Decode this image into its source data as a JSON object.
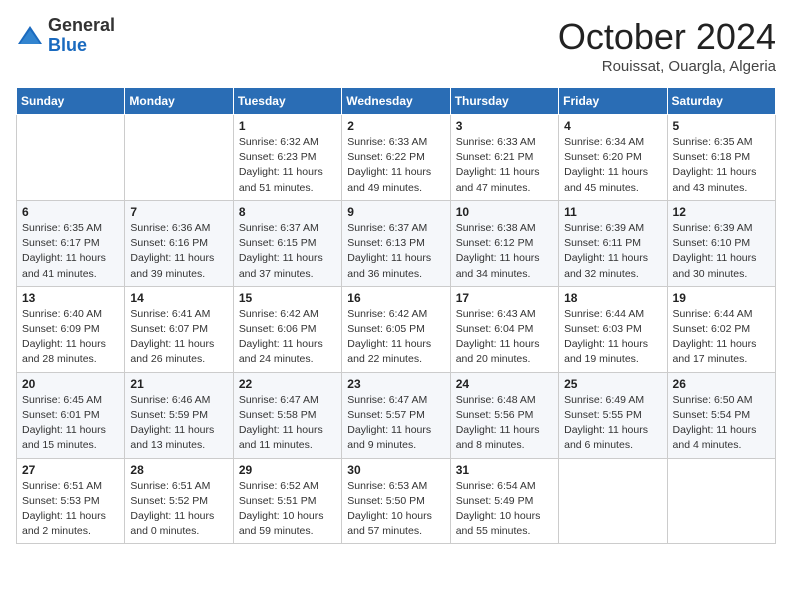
{
  "logo": {
    "general": "General",
    "blue": "Blue"
  },
  "header": {
    "month": "October 2024",
    "location": "Rouissat, Ouargla, Algeria"
  },
  "weekdays": [
    "Sunday",
    "Monday",
    "Tuesday",
    "Wednesday",
    "Thursday",
    "Friday",
    "Saturday"
  ],
  "weeks": [
    [
      {
        "day": "",
        "info": ""
      },
      {
        "day": "",
        "info": ""
      },
      {
        "day": "1",
        "info": "Sunrise: 6:32 AM\nSunset: 6:23 PM\nDaylight: 11 hours and 51 minutes."
      },
      {
        "day": "2",
        "info": "Sunrise: 6:33 AM\nSunset: 6:22 PM\nDaylight: 11 hours and 49 minutes."
      },
      {
        "day": "3",
        "info": "Sunrise: 6:33 AM\nSunset: 6:21 PM\nDaylight: 11 hours and 47 minutes."
      },
      {
        "day": "4",
        "info": "Sunrise: 6:34 AM\nSunset: 6:20 PM\nDaylight: 11 hours and 45 minutes."
      },
      {
        "day": "5",
        "info": "Sunrise: 6:35 AM\nSunset: 6:18 PM\nDaylight: 11 hours and 43 minutes."
      }
    ],
    [
      {
        "day": "6",
        "info": "Sunrise: 6:35 AM\nSunset: 6:17 PM\nDaylight: 11 hours and 41 minutes."
      },
      {
        "day": "7",
        "info": "Sunrise: 6:36 AM\nSunset: 6:16 PM\nDaylight: 11 hours and 39 minutes."
      },
      {
        "day": "8",
        "info": "Sunrise: 6:37 AM\nSunset: 6:15 PM\nDaylight: 11 hours and 37 minutes."
      },
      {
        "day": "9",
        "info": "Sunrise: 6:37 AM\nSunset: 6:13 PM\nDaylight: 11 hours and 36 minutes."
      },
      {
        "day": "10",
        "info": "Sunrise: 6:38 AM\nSunset: 6:12 PM\nDaylight: 11 hours and 34 minutes."
      },
      {
        "day": "11",
        "info": "Sunrise: 6:39 AM\nSunset: 6:11 PM\nDaylight: 11 hours and 32 minutes."
      },
      {
        "day": "12",
        "info": "Sunrise: 6:39 AM\nSunset: 6:10 PM\nDaylight: 11 hours and 30 minutes."
      }
    ],
    [
      {
        "day": "13",
        "info": "Sunrise: 6:40 AM\nSunset: 6:09 PM\nDaylight: 11 hours and 28 minutes."
      },
      {
        "day": "14",
        "info": "Sunrise: 6:41 AM\nSunset: 6:07 PM\nDaylight: 11 hours and 26 minutes."
      },
      {
        "day": "15",
        "info": "Sunrise: 6:42 AM\nSunset: 6:06 PM\nDaylight: 11 hours and 24 minutes."
      },
      {
        "day": "16",
        "info": "Sunrise: 6:42 AM\nSunset: 6:05 PM\nDaylight: 11 hours and 22 minutes."
      },
      {
        "day": "17",
        "info": "Sunrise: 6:43 AM\nSunset: 6:04 PM\nDaylight: 11 hours and 20 minutes."
      },
      {
        "day": "18",
        "info": "Sunrise: 6:44 AM\nSunset: 6:03 PM\nDaylight: 11 hours and 19 minutes."
      },
      {
        "day": "19",
        "info": "Sunrise: 6:44 AM\nSunset: 6:02 PM\nDaylight: 11 hours and 17 minutes."
      }
    ],
    [
      {
        "day": "20",
        "info": "Sunrise: 6:45 AM\nSunset: 6:01 PM\nDaylight: 11 hours and 15 minutes."
      },
      {
        "day": "21",
        "info": "Sunrise: 6:46 AM\nSunset: 5:59 PM\nDaylight: 11 hours and 13 minutes."
      },
      {
        "day": "22",
        "info": "Sunrise: 6:47 AM\nSunset: 5:58 PM\nDaylight: 11 hours and 11 minutes."
      },
      {
        "day": "23",
        "info": "Sunrise: 6:47 AM\nSunset: 5:57 PM\nDaylight: 11 hours and 9 minutes."
      },
      {
        "day": "24",
        "info": "Sunrise: 6:48 AM\nSunset: 5:56 PM\nDaylight: 11 hours and 8 minutes."
      },
      {
        "day": "25",
        "info": "Sunrise: 6:49 AM\nSunset: 5:55 PM\nDaylight: 11 hours and 6 minutes."
      },
      {
        "day": "26",
        "info": "Sunrise: 6:50 AM\nSunset: 5:54 PM\nDaylight: 11 hours and 4 minutes."
      }
    ],
    [
      {
        "day": "27",
        "info": "Sunrise: 6:51 AM\nSunset: 5:53 PM\nDaylight: 11 hours and 2 minutes."
      },
      {
        "day": "28",
        "info": "Sunrise: 6:51 AM\nSunset: 5:52 PM\nDaylight: 11 hours and 0 minutes."
      },
      {
        "day": "29",
        "info": "Sunrise: 6:52 AM\nSunset: 5:51 PM\nDaylight: 10 hours and 59 minutes."
      },
      {
        "day": "30",
        "info": "Sunrise: 6:53 AM\nSunset: 5:50 PM\nDaylight: 10 hours and 57 minutes."
      },
      {
        "day": "31",
        "info": "Sunrise: 6:54 AM\nSunset: 5:49 PM\nDaylight: 10 hours and 55 minutes."
      },
      {
        "day": "",
        "info": ""
      },
      {
        "day": "",
        "info": ""
      }
    ]
  ]
}
